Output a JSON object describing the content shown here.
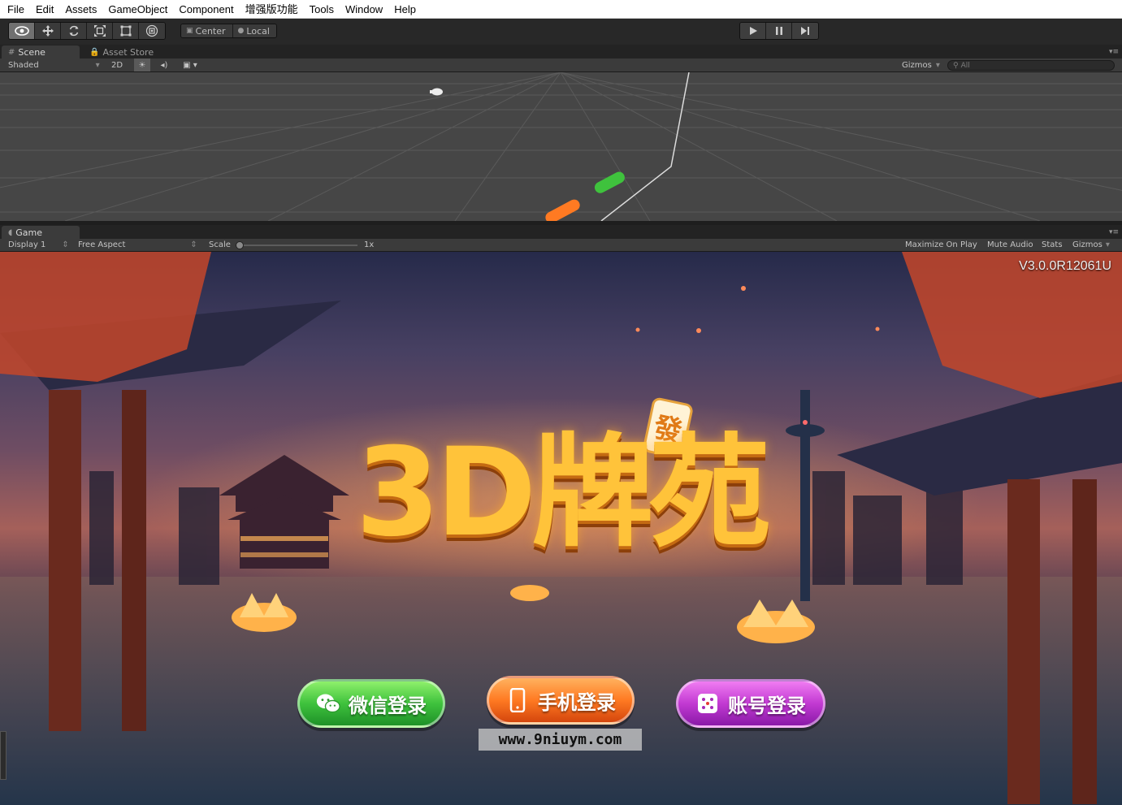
{
  "menu": {
    "items": [
      "File",
      "Edit",
      "Assets",
      "GameObject",
      "Component",
      "增强版功能",
      "Tools",
      "Window",
      "Help"
    ]
  },
  "toolbar": {
    "tools": [
      "hand-icon",
      "move-icon",
      "rotate-icon",
      "scale-icon",
      "rect-icon",
      "transform-icon"
    ],
    "active_tool": "hand-icon",
    "pivot_label": "Center",
    "rotation_label": "Local",
    "play_controls": [
      "play-icon",
      "pause-icon",
      "step-icon"
    ]
  },
  "scene_panel": {
    "tabs": [
      {
        "label": "Scene",
        "icon": "grid-icon"
      },
      {
        "label": "Asset Store",
        "icon": "lock-icon"
      }
    ],
    "draw_mode": "Shaded",
    "mode_2d": "2D",
    "gizmos_label": "Gizmos",
    "search_placeholder": "All"
  },
  "game_panel": {
    "tab_label": "Game",
    "display": "Display 1",
    "aspect": "Free Aspect",
    "scale_label": "Scale",
    "scale_value": "1x",
    "scale_fraction": 0.0,
    "maximize_label": "Maximize On Play",
    "mute_label": "Mute Audio",
    "stats_label": "Stats",
    "gizmos_label": "Gizmos"
  },
  "game": {
    "version": "V3.0.0R12061U",
    "logo": "3D牌苑",
    "buttons": {
      "wechat": "微信登录",
      "phone": "手机登录",
      "account": "账号登录"
    },
    "watermark": "www.9niuym.com"
  },
  "colors": {
    "editor_dark": "#282828",
    "panel_grey": "#3b3b3b",
    "scene_bg": "#464646",
    "wechat_green": "#3fc23d",
    "phone_orange": "#ff7a22",
    "account_purple": "#c23ad2",
    "logo_gold": "#ffc33a"
  }
}
